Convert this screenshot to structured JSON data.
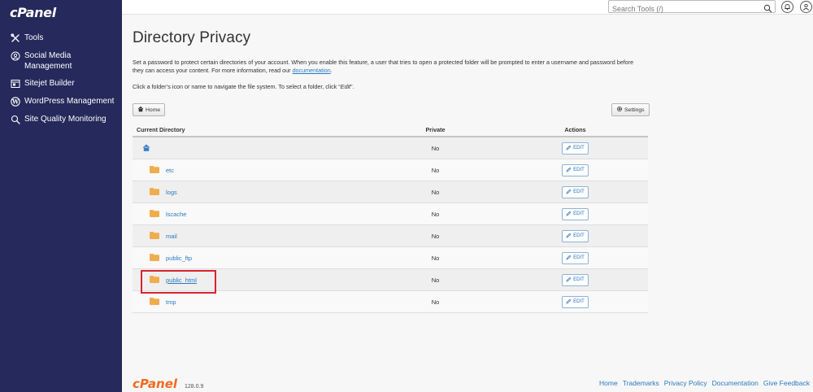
{
  "brand": {
    "logo": "cPanel",
    "version": "128.0.9"
  },
  "sidebar": {
    "items": [
      {
        "label": "Tools",
        "icon": "tools-icon"
      },
      {
        "label": "Social Media Management",
        "icon": "social-media-icon"
      },
      {
        "label": "Sitejet Builder",
        "icon": "sitejet-icon"
      },
      {
        "label": "WordPress Management",
        "icon": "wordpress-icon"
      },
      {
        "label": "Site Quality Monitoring",
        "icon": "site-quality-icon"
      }
    ]
  },
  "topbar": {
    "search_placeholder": "Search Tools (/)"
  },
  "page": {
    "title": "Directory Privacy",
    "desc_text": "Set a password to protect certain directories of your account. When you enable this feature, a user that tries to open a protected folder will be prompted to enter a username and password before they can access your content. For more information, read our ",
    "desc_link": "documentation",
    "desc_end": ".",
    "hint_text": "Click a folder’s icon or name to navigate the file system. To select a folder, click “",
    "hint_em": "Edit",
    "hint_end": "”.",
    "home_button": "Home",
    "settings_button": "Settings"
  },
  "table": {
    "headers": {
      "dir": "Current Directory",
      "private": "Private",
      "actions": "Actions"
    },
    "edit_label": "EDIT",
    "rows": [
      {
        "name": "",
        "private": "No",
        "home": true
      },
      {
        "name": "etc",
        "private": "No"
      },
      {
        "name": "logs",
        "private": "No"
      },
      {
        "name": "lscache",
        "private": "No"
      },
      {
        "name": "mail",
        "private": "No"
      },
      {
        "name": "public_ftp",
        "private": "No"
      },
      {
        "name": "public_html",
        "private": "No",
        "highlighted": true
      },
      {
        "name": "tmp",
        "private": "No"
      }
    ]
  },
  "footer": {
    "links": [
      "Home",
      "Trademarks",
      "Privacy Policy",
      "Documentation",
      "Give Feedback"
    ]
  },
  "colors": {
    "sidebar": "#25295b",
    "link": "#2a7abf",
    "folder": "#f0ad4e",
    "highlight": "#d9232e",
    "brand_orange": "#f26a21"
  }
}
